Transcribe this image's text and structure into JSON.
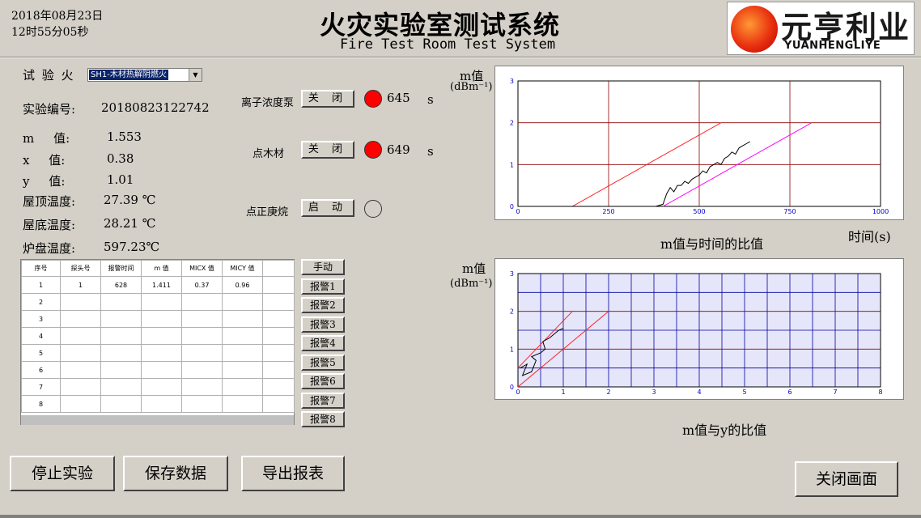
{
  "header": {
    "date": "2018年08月23日",
    "time": "12时55分05秒",
    "title_cn": "火灾实验室测试系统",
    "title_en": "Fire Test Room Test System",
    "logo_cn": "元亨利业",
    "logo_en": "YUANHENGLIYE"
  },
  "fire": {
    "label": "试 验 火",
    "selected": "SH1-木材热解阴燃火"
  },
  "readings": [
    {
      "label": "实验编号:",
      "value": "20180823122742"
    },
    {
      "label": "m     值:",
      "value": "1.553"
    },
    {
      "label": "x     值:",
      "value": "0.38"
    },
    {
      "label": "y     值:",
      "value": "1.01"
    },
    {
      "label": "屋顶温度:",
      "value": "27.39 ℃"
    },
    {
      "label": "屋底温度:",
      "value": "28.21 ℃"
    },
    {
      "label": "炉盘温度:",
      "value": "597.23℃"
    }
  ],
  "controls": [
    {
      "label": "离子浓度泵",
      "button": "关 闭",
      "led": "red",
      "value": "645",
      "unit": "s"
    },
    {
      "label": "点木材",
      "button": "关 闭",
      "led": "red",
      "value": "649",
      "unit": "s"
    },
    {
      "label": "点正庚烷",
      "button": "启 动",
      "led": "off",
      "value": "",
      "unit": ""
    }
  ],
  "table": {
    "headers": [
      "序号",
      "探头号",
      "报警时间",
      "m 值",
      "MICX 值",
      "MICY 值",
      ""
    ],
    "rows": [
      [
        "1",
        "1",
        "628",
        "1.411",
        "0.37",
        "0.96",
        ""
      ],
      [
        "2",
        "",
        "",
        "",
        "",
        "",
        ""
      ],
      [
        "3",
        "",
        "",
        "",
        "",
        "",
        ""
      ],
      [
        "4",
        "",
        "",
        "",
        "",
        "",
        ""
      ],
      [
        "5",
        "",
        "",
        "",
        "",
        "",
        ""
      ],
      [
        "6",
        "",
        "",
        "",
        "",
        "",
        ""
      ],
      [
        "7",
        "",
        "",
        "",
        "",
        "",
        ""
      ],
      [
        "8",
        "",
        "",
        "",
        "",
        "",
        ""
      ]
    ]
  },
  "side_buttons": [
    "手动",
    "报警1",
    "报警2",
    "报警3",
    "报警4",
    "报警5",
    "报警6",
    "报警7",
    "报警8"
  ],
  "bottom_buttons": [
    "停止实验",
    "保存数据",
    "导出报表"
  ],
  "close_button": "关闭画面",
  "chart_data": [
    {
      "type": "line",
      "ylabel": "m值",
      "yunit": "(dBm⁻¹)",
      "xlabel": "时间(s)",
      "caption": "m值与时间的比值",
      "xlim": [
        0,
        1000
      ],
      "ylim": [
        0,
        3
      ],
      "xticks": [
        0,
        250,
        500,
        750,
        1000
      ],
      "yticks": [
        0,
        1,
        2,
        3
      ],
      "grid": true,
      "gridColor": "#8b0000",
      "background": "#ffffff",
      "series": [
        {
          "color": "#ff2020",
          "x": [
            150,
            560
          ],
          "y": [
            0,
            2
          ]
        },
        {
          "color": "#ff00ff",
          "x": [
            400,
            810
          ],
          "y": [
            0,
            2
          ]
        },
        {
          "color": "#000000",
          "x": [
            0,
            380,
            400,
            410,
            420,
            430,
            440,
            450,
            460,
            470,
            480,
            490,
            500,
            510,
            520,
            530,
            540,
            550,
            560,
            570,
            580,
            590,
            600,
            610,
            620,
            630,
            640
          ],
          "y": [
            0,
            0,
            0.05,
            0.3,
            0.45,
            0.35,
            0.5,
            0.5,
            0.6,
            0.55,
            0.65,
            0.7,
            0.75,
            0.85,
            0.8,
            0.95,
            1.0,
            1.05,
            1.0,
            1.15,
            1.2,
            1.3,
            1.25,
            1.4,
            1.45,
            1.5,
            1.55
          ]
        }
      ]
    },
    {
      "type": "scatter",
      "ylabel": "m值",
      "yunit": "(dBm⁻¹)",
      "caption": "m值与y的比值",
      "xlim": [
        0,
        8
      ],
      "ylim": [
        0,
        3
      ],
      "xticks": [
        0,
        1,
        2,
        3,
        4,
        5,
        6,
        7,
        8
      ],
      "yticks": [
        0,
        1,
        2,
        3
      ],
      "grid": true,
      "gridColor": "#0000a0",
      "gridColorH": "#8b0000",
      "background": "#e6e6fa",
      "series": [
        {
          "color": "#ff2020",
          "x": [
            0,
            1.2
          ],
          "y": [
            0.5,
            2
          ]
        },
        {
          "color": "#ff2020",
          "x": [
            0,
            2
          ],
          "y": [
            0,
            2
          ]
        },
        {
          "color": "#000000",
          "x": [
            0.05,
            0.2,
            0.1,
            0.3,
            0.4,
            0.3,
            0.5,
            0.6,
            0.55,
            0.7,
            0.75,
            0.8,
            0.9,
            1.0
          ],
          "y": [
            0.5,
            0.6,
            0.3,
            0.4,
            0.7,
            0.8,
            0.9,
            1.0,
            1.2,
            1.3,
            1.35,
            1.4,
            1.5,
            1.55
          ]
        }
      ]
    }
  ]
}
